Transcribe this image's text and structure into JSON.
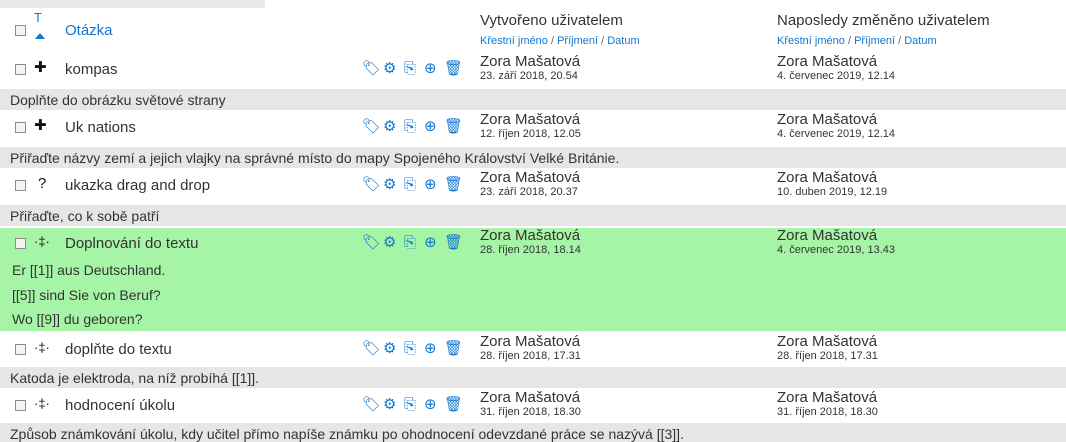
{
  "header": {
    "sort_glyph": "T",
    "question_label": "Otázka",
    "created_title": "Vytvořeno uživatelem",
    "modified_title": "Naposledy změněno uživatelem",
    "sort_links": {
      "first": "Křestní jméno",
      "last": "Příjmení",
      "date": "Datum",
      "separator": "/"
    }
  },
  "questions": [
    {
      "icon": "move-icon",
      "icon_glyph": "✚",
      "name": "kompas",
      "created_by": "Zora Mašatová",
      "created_date": "23. září 2018, 20.54",
      "modified_by": "Zora Mašatová",
      "modified_date": "4. červenec 2019, 12.14",
      "text": "Doplňte do obrázku světové strany"
    },
    {
      "icon": "move-icon",
      "icon_glyph": "✚",
      "name": "Uk nations",
      "created_by": "Zora Mašatová",
      "created_date": "12. říjen 2018, 12.05",
      "modified_by": "Zora Mašatová",
      "modified_date": "4. červenec 2019, 12.14",
      "text": "Přiřaďte názvy zemí a jejich vlajky na správné místo do mapy Spojeného Království Velké Británie."
    },
    {
      "icon": "question-mark-icon",
      "icon_glyph": "?",
      "name": "ukazka drag and drop",
      "created_by": "Zora Mašatová",
      "created_date": "23. září 2018, 20.37",
      "modified_by": "Zora Mašatová",
      "modified_date": "10. duben 2019, 12.19",
      "text": "Přiřaďte, co k sobě patří"
    },
    {
      "icon": "drag-text-icon",
      "icon_glyph": "·‡·",
      "name": "Doplnování do textu",
      "created_by": "Zora Mašatová",
      "created_date": "28. říjen 2018, 18.14",
      "modified_by": "Zora Mašatová",
      "modified_date": "4. červenec 2019, 13.43",
      "text_lines": [
        "Er [[1]] aus Deutschland.",
        "[[5]] sind Sie von Beruf?",
        "Wo [[9]] du geboren?"
      ]
    },
    {
      "icon": "drag-text-icon",
      "icon_glyph": "·‡·",
      "name": "doplňte do textu",
      "created_by": "Zora Mašatová",
      "created_date": "28. říjen 2018, 17.31",
      "modified_by": "Zora Mašatová",
      "modified_date": "28. říjen 2018, 17.31",
      "text": "Katoda je elektroda, na níž probíhá [[1]]."
    },
    {
      "icon": "drag-text-icon",
      "icon_glyph": "·‡·",
      "name": "hodnocení úkolu",
      "created_by": "Zora Mašatová",
      "created_date": "31. říjen 2018, 18.30",
      "modified_by": "Zora Mašatová",
      "modified_date": "31. říjen 2018, 18.30",
      "text": "Způsob známkování úkolu, kdy učitel přímo napíše známku po ohodnocení odevzdané práce se nazývá [[3]]."
    }
  ],
  "action_icons": [
    "tag-icon",
    "gear-icon",
    "duplicate-icon",
    "preview-icon",
    "delete-icon"
  ],
  "colors": {
    "link": "#1177d1",
    "highlight_row": "#a6f5a6",
    "text_row": "#e6e6e6"
  }
}
